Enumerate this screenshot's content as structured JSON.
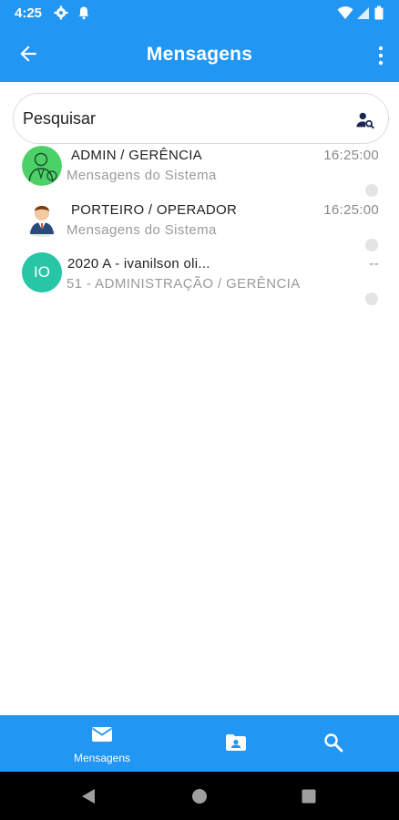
{
  "status_bar": {
    "time": "4:25"
  },
  "appbar": {
    "title": "Mensagens"
  },
  "search": {
    "placeholder": "Pesquisar"
  },
  "conversations": [
    {
      "name": "ADMIN / GERÊNCIA",
      "subtitle": "Mensagens do Sistema",
      "time": "16:25:00",
      "avatar": "admin-avatar-icon"
    },
    {
      "name": "PORTEIRO / OPERADOR",
      "subtitle": "Mensagens do Sistema",
      "time": "16:25:00",
      "avatar": "porter-avatar-icon"
    },
    {
      "name": "2020 A - ivanilson oli...",
      "subtitle": "51 - ADMINISTRAÇÃO / GERÊNCIA",
      "time": "--",
      "initials": "IO"
    }
  ],
  "bottom_nav": {
    "messages_label": "Mensagens"
  },
  "colors": {
    "primary": "#2196f3",
    "avatar_green": "#4cd168",
    "initials_teal": "#26c6a6"
  }
}
